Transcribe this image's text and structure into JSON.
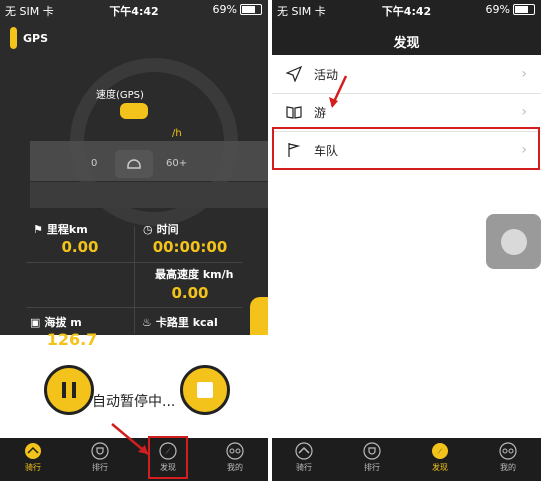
{
  "status": {
    "carrier": "无 SIM 卡",
    "time": "下午4:42",
    "battery": "69%"
  },
  "ride": {
    "gps_label": "GPS",
    "speed_label": "速度(GPS)",
    "speed_unit": "/h",
    "tick_low": "0",
    "tick_high": "60+",
    "distance_label": "里程km",
    "distance_value": "0.00",
    "time_label": "时间",
    "time_value": "00:00:00",
    "max_speed_label": "最高速度 km/h",
    "max_speed_value": "0.00",
    "altitude_label": "海拔 m",
    "altitude_value": "126.7",
    "calorie_label": "卡路里 kcal",
    "auto_pause": "自动暂停中..."
  },
  "tabs": [
    {
      "label": "骑行"
    },
    {
      "label": "排行"
    },
    {
      "label": "发现"
    },
    {
      "label": "我的"
    }
  ],
  "discover": {
    "title": "发现",
    "rows": [
      {
        "label": "活动"
      },
      {
        "label": "游"
      },
      {
        "label": "车队"
      }
    ]
  },
  "colors": {
    "accent": "#f3c31b",
    "highlight": "#d21e1e",
    "dark": "#2b2b2b"
  }
}
